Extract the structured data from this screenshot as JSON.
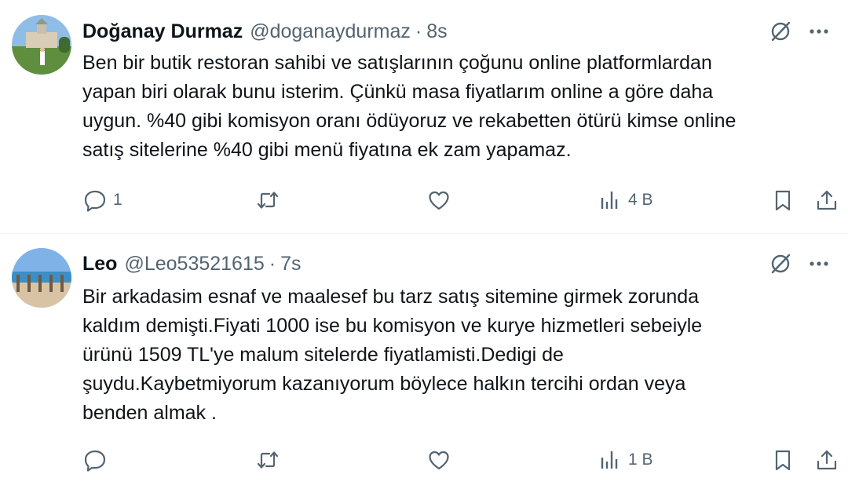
{
  "tweets": [
    {
      "display_name": "Doğanay Durmaz",
      "handle": "@doganaydurmaz",
      "separator": "·",
      "time": "8s",
      "text": "Ben bir butik restoran sahibi ve satışlarının çoğunu online platformlardan\nyapan biri olarak bunu isterim. Çünkü masa fiyatlarım online a göre daha\nuygun. %40 gibi komisyon oranı ödüyoruz ve rekabetten ötürü kimse online\nsatış sitelerine %40 gibi menü fiyatına ek zam yapamaz.",
      "reply_count": "1",
      "retweet_count": "",
      "like_count": "",
      "view_count": "4 B"
    },
    {
      "display_name": "Leo",
      "handle": "@Leo53521615",
      "separator": "·",
      "time": "7s",
      "text": "Bir arkadasim esnaf ve maalesef bu  tarz satış sitemine girmek zorunda\nkaldım demişti.Fiyati 1000 ise bu komisyon ve kurye hizmetleri sebeiyle\nürünü 1509 TL'ye malum sitelerde fiyatlamisti.Dedigi de\nşuydu.Kaybetmiyorum kazanıyorum böylece halkın tercihi ordan veya\nbenden almak .",
      "reply_count": "",
      "retweet_count": "",
      "like_count": "",
      "view_count": "1 B"
    }
  ],
  "icons": {
    "reply": "reply-icon",
    "retweet": "retweet-icon",
    "like": "heart-icon",
    "views": "views-icon",
    "bookmark": "bookmark-icon",
    "share": "share-icon",
    "grok": "grok-icon",
    "more": "more-icon"
  },
  "colors": {
    "text": "#0f1419",
    "secondary": "#536471",
    "divider": "#eff3f4"
  }
}
